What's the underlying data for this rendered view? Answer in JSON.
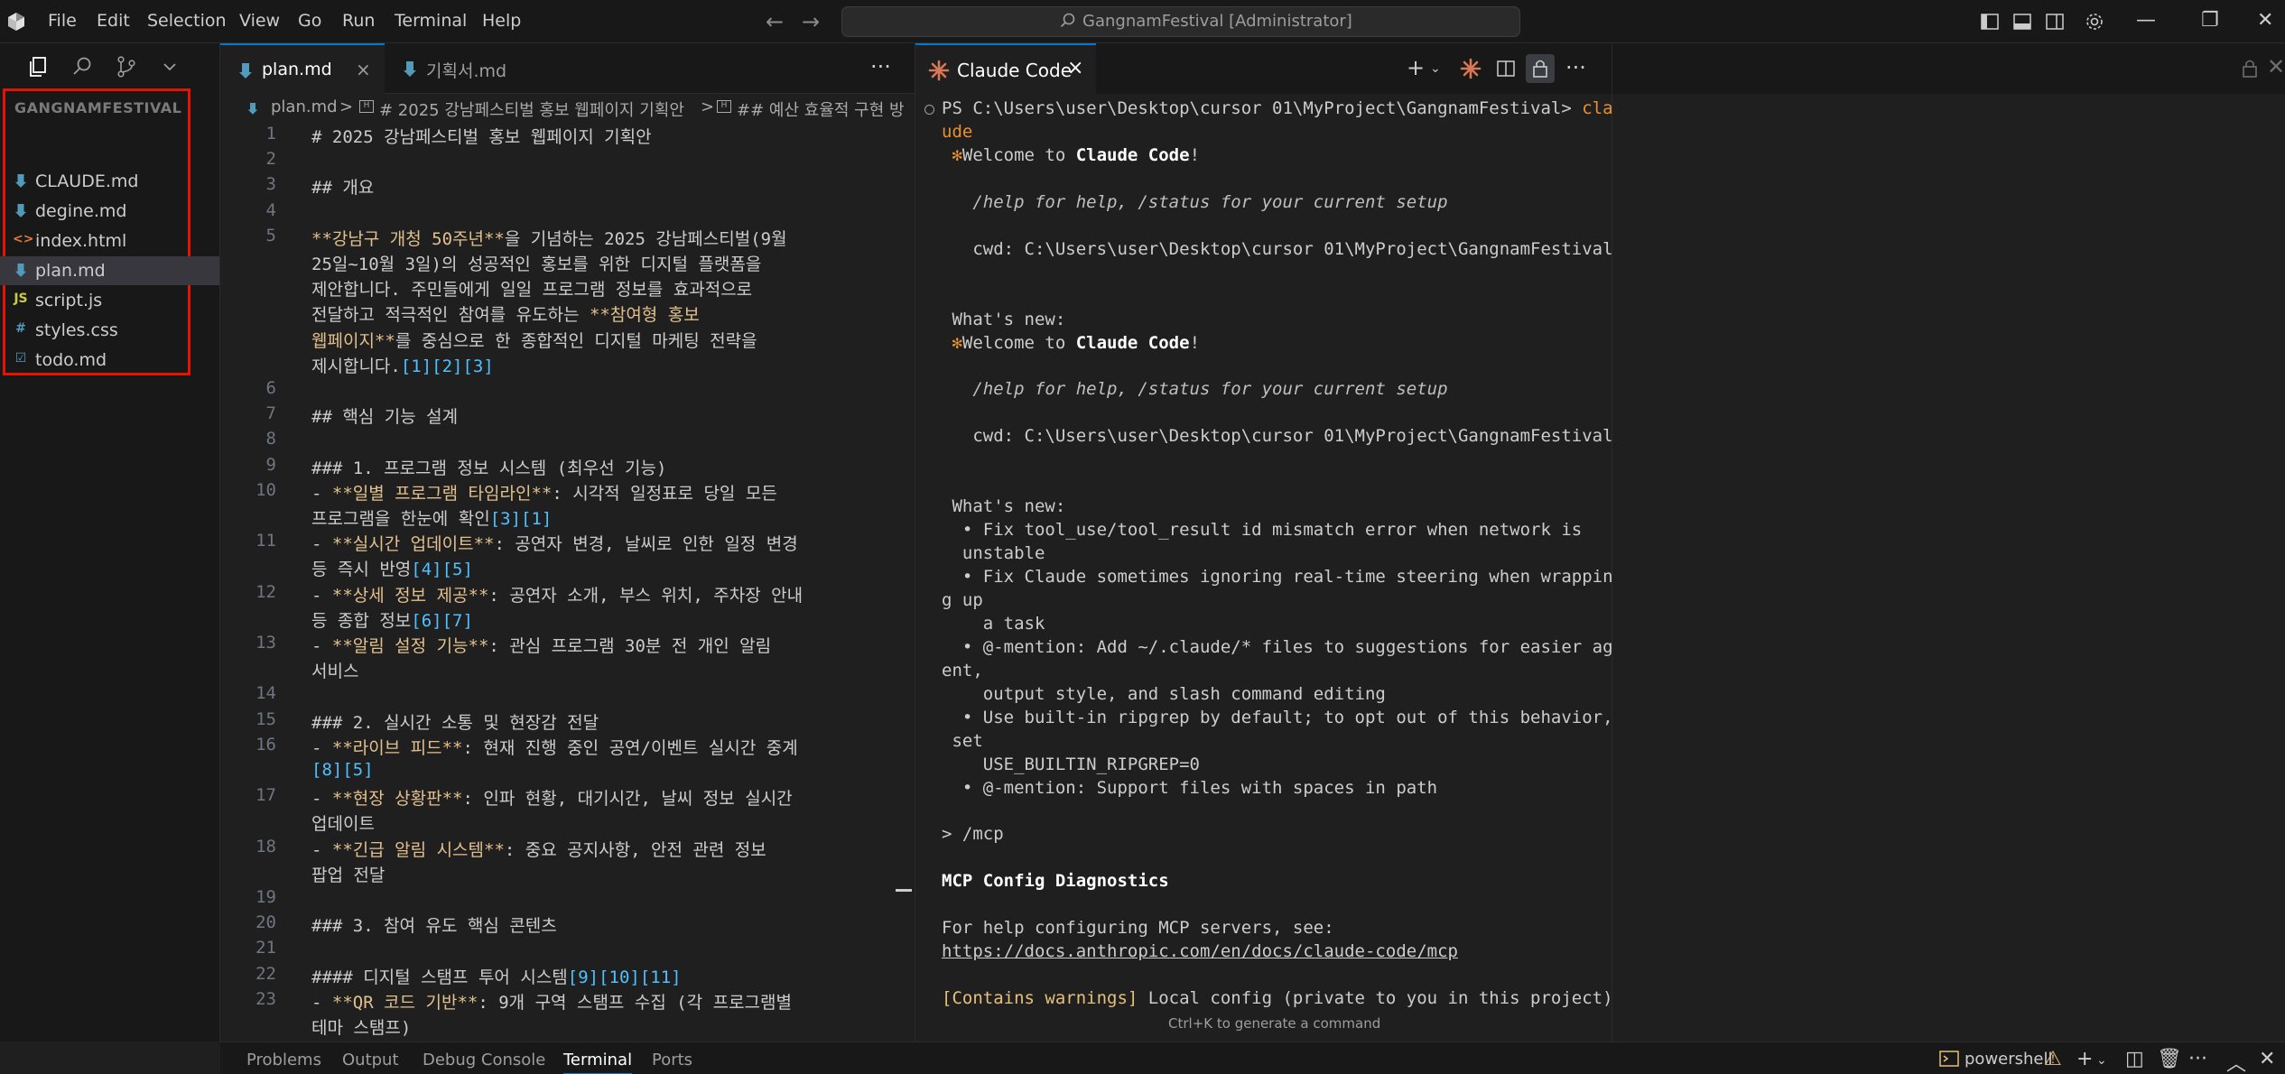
{
  "menu": [
    "File",
    "Edit",
    "Selection",
    "View",
    "Go",
    "Run",
    "Terminal",
    "Help"
  ],
  "command_center": "GangnamFestival [Administrator]",
  "explorer": {
    "title": "GANGNAMFESTIVAL",
    "files": [
      {
        "name": "CLAUDE.md",
        "icon": "markdown-icon"
      },
      {
        "name": "degine.md",
        "icon": "markdown-icon"
      },
      {
        "name": "index.html",
        "icon": "html-icon"
      },
      {
        "name": "plan.md",
        "icon": "markdown-icon"
      },
      {
        "name": "script.js",
        "icon": "js-icon"
      },
      {
        "name": "styles.css",
        "icon": "css-icon"
      },
      {
        "name": "todo.md",
        "icon": "todo-icon"
      }
    ],
    "highlight_color": "#e51400"
  },
  "editor": {
    "tabs": [
      {
        "label": "plan.md",
        "active": true,
        "close": "×"
      },
      {
        "label": "기획서.md",
        "active": false
      }
    ],
    "breadcrumb": [
      "plan.md",
      ">",
      "# 2025 강남페스티벌 홍보 웹페이지 기획안",
      ">",
      "## 예산 효율적 구현 방"
    ],
    "more": "···"
  },
  "code_lines": [
    {
      "n": "1",
      "segs": [
        [
          "# 2025 강남페스티벌 홍보 웹페이지 기획안",
          ""
        ]
      ]
    },
    {
      "n": "2",
      "segs": []
    },
    {
      "n": "3",
      "segs": [
        [
          "## 개요",
          ""
        ]
      ]
    },
    {
      "n": "4",
      "segs": []
    },
    {
      "n": "5",
      "segs": [
        [
          "**강남구 개청 50주년**",
          "y"
        ],
        [
          "을 기념하는 2025 강남페스티벌(9월",
          ""
        ]
      ]
    },
    {
      "n": "",
      "segs": [
        [
          "25일~10월 3일)의 성공적인 홍보를 위한 디지털 플랫폼을",
          ""
        ]
      ]
    },
    {
      "n": "",
      "segs": [
        [
          "제안합니다. 주민들에게 일일 프로그램 정보를 효과적으로",
          ""
        ]
      ]
    },
    {
      "n": "",
      "segs": [
        [
          "전달하고 적극적인 참여를 유도하는 ",
          ""
        ],
        [
          "**참여형 홍보",
          "y"
        ]
      ]
    },
    {
      "n": "",
      "segs": [
        [
          "웹페이지**",
          "y"
        ],
        [
          "를 중심으로 한 종합적인 디지털 마케팅 전략을",
          ""
        ]
      ]
    },
    {
      "n": "",
      "segs": [
        [
          "제시합니다.",
          ""
        ],
        [
          "[1][2][3]",
          "b"
        ]
      ]
    },
    {
      "n": "6",
      "segs": []
    },
    {
      "n": "7",
      "segs": [
        [
          "## 핵심 기능 설계",
          ""
        ]
      ]
    },
    {
      "n": "8",
      "segs": []
    },
    {
      "n": "9",
      "segs": [
        [
          "### 1. 프로그램 정보 시스템 (최우선 기능)",
          ""
        ]
      ]
    },
    {
      "n": "10",
      "segs": [
        [
          "- ",
          ""
        ],
        [
          "**일별 프로그램 타임라인**",
          "y"
        ],
        [
          ": 시각적 일정표로 당일 모든",
          ""
        ]
      ]
    },
    {
      "n": "",
      "segs": [
        [
          "프로그램을 한눈에 확인",
          ""
        ],
        [
          "[3][1]",
          "b"
        ]
      ]
    },
    {
      "n": "11",
      "segs": [
        [
          "- ",
          ""
        ],
        [
          "**실시간 업데이트**",
          "y"
        ],
        [
          ": 공연자 변경, 날씨로 인한 일정 변경",
          ""
        ]
      ]
    },
    {
      "n": "",
      "segs": [
        [
          "등 즉시 반영",
          ""
        ],
        [
          "[4][5]",
          "b"
        ]
      ]
    },
    {
      "n": "12",
      "segs": [
        [
          "- ",
          ""
        ],
        [
          "**상세 정보 제공**",
          "y"
        ],
        [
          ": 공연자 소개, 부스 위치, 주차장 안내",
          ""
        ]
      ]
    },
    {
      "n": "",
      "segs": [
        [
          "등 종합 정보",
          ""
        ],
        [
          "[6][7]",
          "b"
        ]
      ]
    },
    {
      "n": "13",
      "segs": [
        [
          "- ",
          ""
        ],
        [
          "**알림 설정 기능**",
          "y"
        ],
        [
          ": 관심 프로그램 30분 전 개인 알림",
          ""
        ]
      ]
    },
    {
      "n": "",
      "segs": [
        [
          "서비스",
          ""
        ]
      ]
    },
    {
      "n": "14",
      "segs": []
    },
    {
      "n": "15",
      "segs": [
        [
          "### 2. 실시간 소통 및 현장감 전달",
          ""
        ]
      ]
    },
    {
      "n": "16",
      "segs": [
        [
          "- ",
          ""
        ],
        [
          "**라이브 피드**",
          "y"
        ],
        [
          ": 현재 진행 중인 공연/이벤트 실시간 중계",
          ""
        ]
      ]
    },
    {
      "n": "",
      "segs": [
        [
          "[8][5]",
          "b"
        ]
      ]
    },
    {
      "n": "17",
      "segs": [
        [
          "- ",
          ""
        ],
        [
          "**현장 상황판**",
          "y"
        ],
        [
          ": 인파 현황, 대기시간, 날씨 정보 실시간",
          ""
        ]
      ]
    },
    {
      "n": "",
      "segs": [
        [
          "업데이트",
          ""
        ]
      ]
    },
    {
      "n": "18",
      "segs": [
        [
          "- ",
          ""
        ],
        [
          "**긴급 알림 시스템**",
          "y"
        ],
        [
          ": 중요 공지사항, 안전 관련 정보",
          ""
        ]
      ]
    },
    {
      "n": "",
      "segs": [
        [
          "팝업 전달",
          ""
        ]
      ]
    },
    {
      "n": "19",
      "segs": []
    },
    {
      "n": "20",
      "segs": [
        [
          "### 3. 참여 유도 핵심 콘텐츠",
          ""
        ]
      ]
    },
    {
      "n": "21",
      "segs": []
    },
    {
      "n": "22",
      "segs": [
        [
          "#### 디지털 스탬프 투어 시스템",
          ""
        ],
        [
          "[9][10][11]",
          "b"
        ]
      ]
    },
    {
      "n": "23",
      "segs": [
        [
          "- ",
          ""
        ],
        [
          "**QR 코드 기반**",
          "y"
        ],
        [
          ": 9개 구역 스탬프 수집 (각 프로그램별",
          ""
        ]
      ]
    },
    {
      "n": "",
      "segs": [
        [
          "테마 스탬프)",
          ""
        ]
      ]
    }
  ],
  "claude": {
    "tab_label": "Claude Code",
    "tab_close": "×",
    "hint": "Ctrl+K to generate a command",
    "lines": [
      [
        [
          "PS C:\\Users\\user\\Desktop\\cursor 01\\MyProject\\GangnamFestival> ",
          ""
        ],
        [
          "cla",
          "orange"
        ]
      ],
      [
        [
          "ude",
          "orange"
        ]
      ],
      [
        [
          " ✻",
          "orange"
        ],
        [
          "Welcome to ",
          ""
        ],
        [
          "Claude Code",
          "bold"
        ],
        [
          "!",
          ""
        ]
      ],
      [],
      [
        [
          "   /help for help, /status for your current setup",
          "ital"
        ]
      ],
      [],
      [
        [
          "   cwd: C:\\Users\\user\\Desktop\\cursor 01\\MyProject\\GangnamFestival",
          ""
        ]
      ],
      [],
      [],
      [
        [
          " What's new:",
          ""
        ]
      ],
      [
        [
          " ✻",
          "orange"
        ],
        [
          "Welcome to ",
          ""
        ],
        [
          "Claude Code",
          "bold"
        ],
        [
          "!",
          ""
        ]
      ],
      [],
      [
        [
          "   /help for help, /status for your current setup",
          "ital"
        ]
      ],
      [],
      [
        [
          "   cwd: C:\\Users\\user\\Desktop\\cursor 01\\MyProject\\GangnamFestival",
          ""
        ]
      ],
      [],
      [],
      [
        [
          " What's new:",
          ""
        ]
      ],
      [
        [
          "  • Fix tool_use/tool_result id mismatch error when network is",
          ""
        ]
      ],
      [
        [
          "  unstable",
          ""
        ]
      ],
      [
        [
          "  • Fix Claude sometimes ignoring real-time steering when wrappin",
          ""
        ]
      ],
      [
        [
          "g up",
          ""
        ]
      ],
      [
        [
          "    a task",
          ""
        ]
      ],
      [
        [
          "  • @-mention: Add ~/.claude/* files to suggestions for easier ag",
          ""
        ]
      ],
      [
        [
          "ent,",
          ""
        ]
      ],
      [
        [
          "    output style, and slash command editing",
          ""
        ]
      ],
      [
        [
          "  • Use built-in ripgrep by default; to opt out of this behavior,",
          ""
        ]
      ],
      [
        [
          " set",
          ""
        ]
      ],
      [
        [
          "    USE_BUILTIN_RIPGREP=0",
          ""
        ]
      ],
      [
        [
          "  • @-mention: Support files with spaces in path",
          ""
        ]
      ],
      [],
      [
        [
          "> /mcp",
          ""
        ]
      ],
      [],
      [
        [
          "MCP Config Diagnostics",
          "bold"
        ]
      ],
      [],
      [
        [
          "For help configuring MCP servers, see:",
          ""
        ]
      ],
      [
        [
          "https://docs.anthropic.com/en/docs/claude-code/mcp",
          "link"
        ]
      ],
      [],
      [
        [
          "[Contains warnings]",
          "warn"
        ],
        [
          " Local config (private to you in this project)",
          ""
        ]
      ]
    ]
  },
  "panel": {
    "tabs": [
      "Problems",
      "Output",
      "Debug Console",
      "Terminal",
      "Ports"
    ],
    "active_tab": "Terminal",
    "shell": "powershell"
  },
  "colors": {
    "accent": "#0078d4",
    "claude_orange": "#d97757",
    "markdown_bold": "#e2c08d",
    "reference": "#4fc1ff"
  }
}
